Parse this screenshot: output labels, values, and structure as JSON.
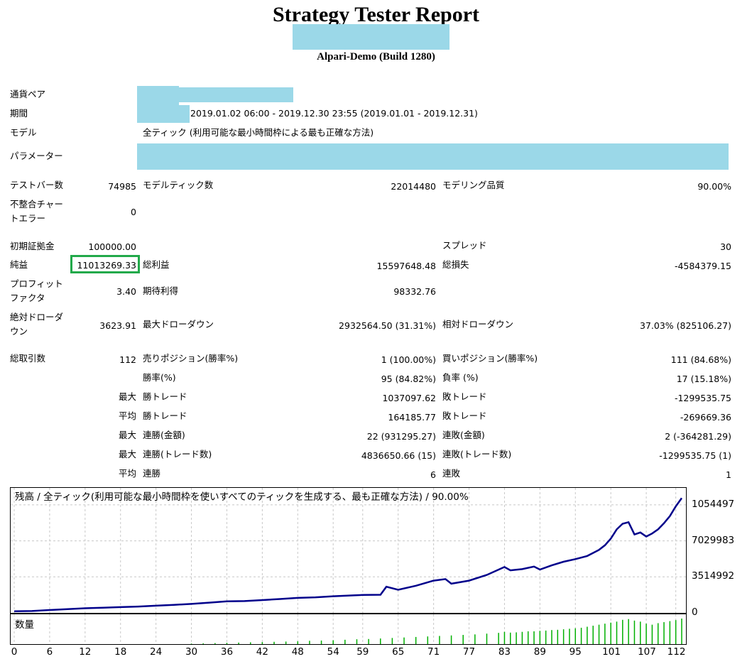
{
  "report": {
    "title": "Strategy Tester Report",
    "server": "Alpari-Demo (Build 1280)"
  },
  "settings": {
    "symbol_label": "通貨ペア",
    "period_label": "期間",
    "period_value": "2019.01.02 06:00 - 2019.12.30 23:55 (2019.01.01 - 2019.12.31)",
    "model_label": "モデル",
    "model_value": "全ティック (利用可能な最小時間枠による最も正確な方法)",
    "params_label": "パラメーター"
  },
  "stats": {
    "bars_label": "テストバー数",
    "bars": "74985",
    "ticks_label": "モデルティック数",
    "ticks": "22014480",
    "quality_label": "モデリング品質",
    "quality": "90.00%",
    "mismatch_label_1": "不整合チャー",
    "mismatch_label_2": "トエラー",
    "mismatch": "0",
    "deposit_label": "初期証拠金",
    "deposit": "100000.00",
    "spread_label": "スプレッド",
    "spread": "30",
    "net_label": "純益",
    "net": "11013269.33",
    "gross_profit_label": "総利益",
    "gross_profit": "15597648.48",
    "gross_loss_label": "総損失",
    "gross_loss": "-4584379.15",
    "pf_label_1": "プロフィット",
    "pf_label_2": "ファクタ",
    "pf": "3.40",
    "expected_label": "期待利得",
    "expected": "98332.76",
    "abs_dd_label_1": "絶対ドローダ",
    "abs_dd_label_2": "ウン",
    "abs_dd": "3623.91",
    "max_dd_label": "最大ドローダウン",
    "max_dd": "2932564.50 (31.31%)",
    "rel_dd_label": "相対ドローダウン",
    "rel_dd": "37.03% (825106.27)",
    "trades_label": "総取引数",
    "trades": "112",
    "short_label": "売りポジション(勝率%)",
    "short": "1 (100.00%)",
    "long_label": "買いポジション(勝率%)",
    "long": "111 (84.68%)",
    "win_pct_label": "勝率(%)",
    "win_pct": "95 (84.82%)",
    "loss_pct_label": "負率 (%)",
    "loss_pct": "17 (15.18%)",
    "max_label": "最大",
    "avg_label": "平均",
    "largest_win_label": "勝トレード",
    "largest_win": "1037097.62",
    "largest_loss_label": "敗トレード",
    "largest_loss": "-1299535.75",
    "avg_win_label": "勝トレード",
    "avg_win": "164185.77",
    "avg_loss_label": "敗トレード",
    "avg_loss": "-269669.36",
    "cons_win_money_label": "連勝(金額)",
    "cons_win_money": "22 (931295.27)",
    "cons_loss_money_label": "連敗(金額)",
    "cons_loss_money": "2 (-364281.29)",
    "cons_win_count_label": "連勝(トレード数)",
    "cons_win_count": "4836650.66 (15)",
    "cons_loss_count_label": "連敗(トレード数)",
    "cons_loss_count": "-1299535.75 (1)",
    "avg_cons_win_label": "連勝",
    "avg_cons_win": "6",
    "avg_cons_loss_label": "連敗",
    "avg_cons_loss": "1"
  },
  "chart_data": {
    "type": "line",
    "title": "残高 / 全ティック(利用可能な最小時間枠を使いすべてのティックを生成する、最も正確な方法) / 90.00%",
    "volume_title": "数量",
    "line_color": "#00008b",
    "volume_color": "#00b000",
    "ylim": [
      0,
      12200000
    ],
    "yticks": [
      "0",
      "3514992",
      "7029983",
      "1054497"
    ],
    "ytick_values": [
      0,
      3514992,
      7029983,
      10544975
    ],
    "xlim": [
      0,
      113
    ],
    "xticks": [
      0,
      6,
      12,
      18,
      24,
      30,
      36,
      42,
      48,
      54,
      59,
      65,
      71,
      77,
      83,
      89,
      95,
      101,
      107,
      112
    ],
    "grid": true,
    "x": [
      0,
      3,
      6,
      9,
      12,
      15,
      18,
      21,
      24,
      27,
      30,
      33,
      36,
      39,
      42,
      45,
      48,
      51,
      54,
      57,
      59,
      62,
      63,
      65,
      68,
      71,
      73,
      74,
      77,
      80,
      83,
      84,
      86,
      88,
      89,
      91,
      93,
      95,
      97,
      99,
      100,
      101,
      102,
      103,
      104,
      105,
      106,
      107,
      108,
      109,
      110,
      111,
      112,
      113
    ],
    "y": [
      150000,
      180000,
      280000,
      360000,
      450000,
      500000,
      560000,
      620000,
      700000,
      780000,
      870000,
      1000000,
      1120000,
      1150000,
      1250000,
      1350000,
      1460000,
      1520000,
      1620000,
      1700000,
      1750000,
      1770000,
      2550000,
      2250000,
      2650000,
      3150000,
      3300000,
      2850000,
      3150000,
      3700000,
      4480000,
      4150000,
      4270000,
      4520000,
      4230000,
      4640000,
      4990000,
      5250000,
      5550000,
      6150000,
      6600000,
      7250000,
      8150000,
      8700000,
      8850000,
      7650000,
      7850000,
      7450000,
      7750000,
      8150000,
      8750000,
      9450000,
      10400000,
      11200000
    ],
    "volume_x": [
      30,
      32,
      34,
      36,
      38,
      40,
      42,
      44,
      46,
      48,
      50,
      52,
      54,
      56,
      58,
      60,
      62,
      64,
      66,
      68,
      70,
      72,
      74,
      76,
      78,
      80,
      82,
      83,
      84,
      85,
      86,
      87,
      88,
      89,
      90,
      91,
      92,
      93,
      94,
      95,
      96,
      97,
      98,
      99,
      100,
      101,
      102,
      103,
      104,
      105,
      106,
      107,
      108,
      109,
      110,
      111,
      112,
      113
    ],
    "volume": [
      0.02,
      0.03,
      0.04,
      0.05,
      0.06,
      0.07,
      0.08,
      0.09,
      0.1,
      0.11,
      0.13,
      0.14,
      0.15,
      0.17,
      0.19,
      0.2,
      0.22,
      0.24,
      0.26,
      0.28,
      0.3,
      0.32,
      0.34,
      0.36,
      0.38,
      0.41,
      0.44,
      0.48,
      0.45,
      0.46,
      0.48,
      0.5,
      0.5,
      0.52,
      0.53,
      0.55,
      0.56,
      0.58,
      0.6,
      0.62,
      0.64,
      0.68,
      0.72,
      0.76,
      0.8,
      0.84,
      0.88,
      0.95,
      0.98,
      0.92,
      0.88,
      0.8,
      0.76,
      0.82,
      0.86,
      0.9,
      0.94,
      1.0
    ]
  }
}
